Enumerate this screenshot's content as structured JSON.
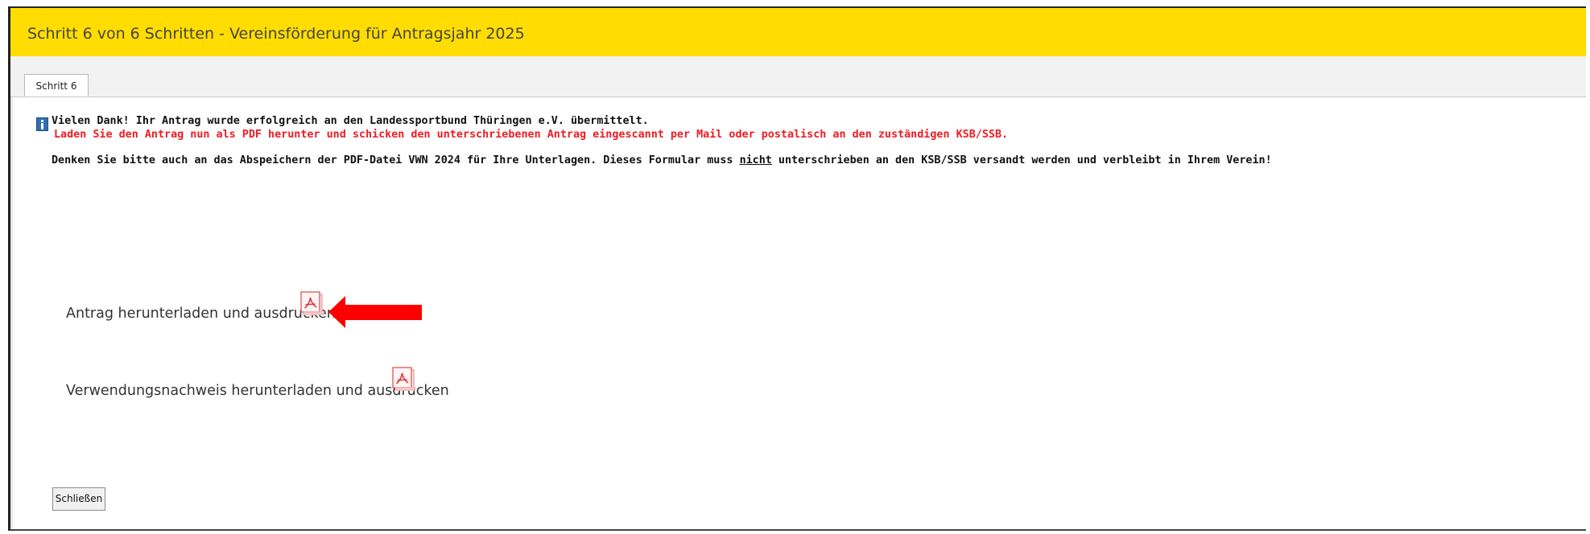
{
  "window": {
    "title": "Schritt 6 von 6 Schritten - Vereinsförderung für Antragsjahr 2025"
  },
  "tabs": [
    {
      "label": "Schritt 6",
      "active": true
    }
  ],
  "messages": {
    "success": "Vielen Dank! Ihr Antrag wurde erfolgreich an den Landessportbund Thüringen e.V. übermittelt.",
    "instruction": "Laden Sie den Antrag nun als PDF herunter und schicken den unterschriebenen Antrag eingescannt per Mail oder postalisch an den zuständigen KSB/SSB.",
    "reminder_before": "Denken Sie bitte auch an das Abspeichern der PDF-Datei VWN 2024 für Ihre Unterlagen. Dieses Formular muss ",
    "reminder_emphasis": "nicht",
    "reminder_after": " unterschrieben an den KSB/SSB versandt werden und verbleibt in Ihrem Verein!"
  },
  "downloads": [
    {
      "label": "Antrag herunterladen und ausdrucken",
      "icon": "pdf-icon"
    },
    {
      "label": "Verwendungsnachweis herunterladen und ausdrucken",
      "icon": "pdf-icon"
    }
  ],
  "buttons": {
    "close_label": "Schließen"
  },
  "colors": {
    "title_bar": "#ffdd00",
    "instruction_text": "#ee1c24",
    "arrow": "#ff0000",
    "info_icon": "#2f6fb2"
  },
  "icons": {
    "info": "info-icon",
    "pdf": "pdf-icon",
    "annotation": "arrow-left-icon"
  }
}
